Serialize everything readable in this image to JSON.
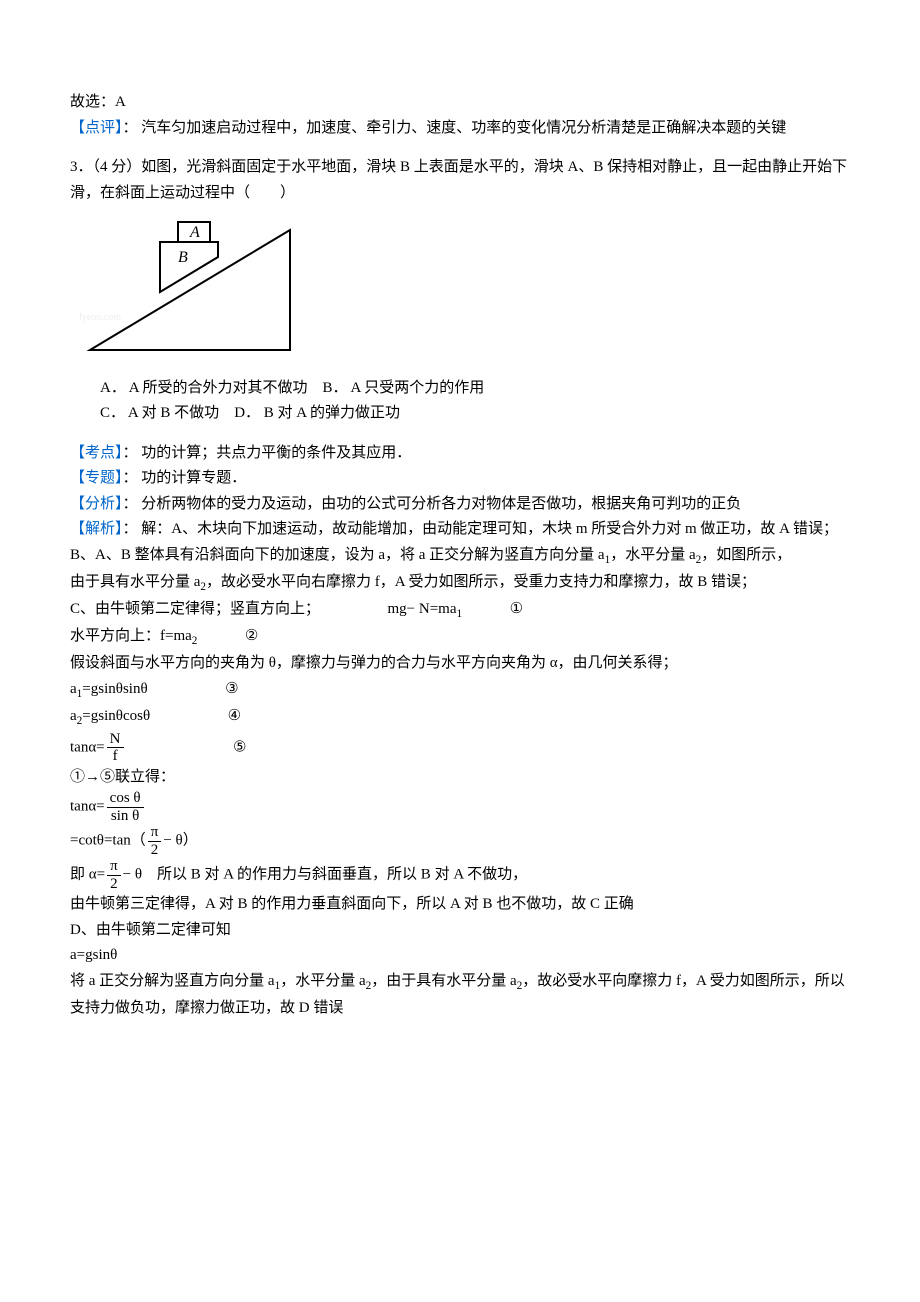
{
  "prev_answer": {
    "line1": "故选：A",
    "comment_label": "【点评】",
    "comment_text": "： 汽车匀加速启动过程中，加速度、牵引力、速度、功率的变化情况分析清楚是正确解决本题的关键"
  },
  "question3": {
    "stem": "3．（4 分）如图，光滑斜面固定于水平地面，滑块 B 上表面是水平的，滑块 A、B 保持相对静止，且一起由静止开始下滑，在斜面上运动过程中（　　）",
    "watermark": "Jyeoo.com",
    "diagram": {
      "labelA": "A",
      "labelB": "B"
    },
    "options": {
      "lineAB": "A． A 所受的合外力对其不做功　B． A 只受两个力的作用",
      "lineCD": "C． A 对 B 不做功　D． B 对 A 的弹力做正功"
    },
    "kaodian_label": "【考点】",
    "kaodian_text": "： 功的计算；共点力平衡的条件及其应用．",
    "zhuanti_label": "【专题】",
    "zhuanti_text": "： 功的计算专题．",
    "fenxi_label": "【分析】",
    "fenxi_text": "： 分析两物体的受力及运动，由功的公式可分析各力对物体是否做功，根据夹角可判功的正负",
    "jiexi_label": "【解析】",
    "jiexi_lines": {
      "l1": "： 解：A、木块向下加速运动，故动能增加，由动能定理可知，木块 m 所受合外力对 m 做正功，故 A 错误；",
      "l2_a": "B、A、B 整体具有沿斜面向下的加速度，设为 a，将 a 正交分解为竖直方向分量 a",
      "l2_b": "，水平分量 a",
      "l2_c": "，如图所示，",
      "l3_a": "由于具有水平分量 a",
      "l3_b": "，故必受水平向右摩擦力 f，A 受力如图所示，受重力支持力和摩擦力，故 B 错误；",
      "l4_a": "C、由牛顿第二定律得；竖直方向上；",
      "l4_b": "mg− N=ma",
      "l4_c": "①",
      "l5_a": "水平方向上：f=ma",
      "l5_b": "②",
      "l6": "假设斜面与水平方向的夹角为 θ，摩擦力与弹力的合力与水平方向夹角为 α，由几何关系得；",
      "l7_a": "a",
      "l7_b": "=gsinθsinθ",
      "l7_c": "③",
      "l8_a": "a",
      "l8_b": "=gsinθcosθ",
      "l8_c": "④",
      "l9_a": "tanα=",
      "l9_N": "N",
      "l9_f": "f",
      "l9_b": "⑤",
      "l10": "①→⑤联立得：",
      "l11_a": "tanα=",
      "l11_num": "cos θ",
      "l11_den": "sin θ",
      "l12_a": "=cotθ=tan（",
      "l12_num": "π",
      "l12_den": "2",
      "l12_b": "− θ）",
      "l13_a": "即 α=",
      "l13_num": "π",
      "l13_den": "2",
      "l13_b": "− θ　所以 B 对 A 的作用力与斜面垂直，所以 B 对 A 不做功，",
      "l14": "由牛顿第三定律得，A 对 B 的作用力垂直斜面向下，所以 A 对 B 也不做功，故 C 正确",
      "l15": "D、由牛顿第二定律可知",
      "l16": "a=gsinθ",
      "l17_a": "将 a 正交分解为竖直方向分量 a",
      "l17_b": "，水平分量 a",
      "l17_c": "，由于具有水平分量 a",
      "l17_d": "，故必受水平向摩擦力 f，A 受力如图所示，所以支持力做负功，摩擦力做正功，故 D 错误"
    },
    "subs": {
      "one": "1",
      "two": "2"
    }
  }
}
